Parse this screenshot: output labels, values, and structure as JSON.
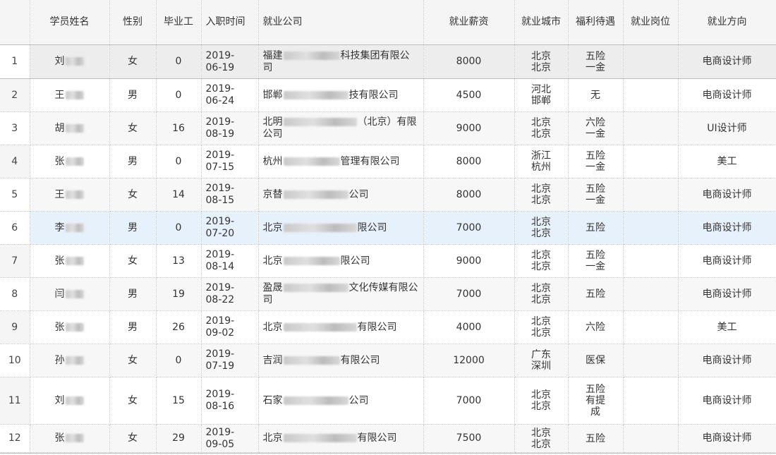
{
  "columns": [
    "",
    "学员姓名",
    "性别",
    "毕业工",
    "入职时间",
    "就业公司",
    "就业薪资",
    "就业城市",
    "福利待遇",
    "就业岗位",
    "就业方向"
  ],
  "rows": [
    {
      "num": "1",
      "name": "刘",
      "gender": "女",
      "years": "0",
      "date": [
        "2019-",
        "06-19"
      ],
      "company_pre": "福建",
      "company_post": "科技集团有限公司",
      "salary": "8000",
      "city": [
        "北京",
        "北京"
      ],
      "welfare": [
        "五险",
        "一金"
      ],
      "position": "",
      "direction": "电商设计师"
    },
    {
      "num": "2",
      "name": "王",
      "gender": "男",
      "years": "0",
      "date": [
        "2019-",
        "06-24"
      ],
      "company_pre": "邯郸",
      "company_post": "技有限公司",
      "salary": "4500",
      "city": [
        "河北",
        "邯郸"
      ],
      "welfare": [
        "无"
      ],
      "position": "",
      "direction": "电商设计师"
    },
    {
      "num": "3",
      "name": "胡",
      "gender": "女",
      "years": "16",
      "date": [
        "2019-",
        "08-19"
      ],
      "company_pre": "北明",
      "company_post": "（北京）有限公司",
      "salary": "9000",
      "city": [
        "北京",
        "北京"
      ],
      "welfare": [
        "六险",
        "一金"
      ],
      "position": "",
      "direction": "UI设计师"
    },
    {
      "num": "4",
      "name": "张",
      "gender": "男",
      "years": "0",
      "date": [
        "2019-",
        "07-15"
      ],
      "company_pre": "杭州",
      "company_post": "管理有限公司",
      "salary": "8000",
      "city": [
        "浙江",
        "杭州"
      ],
      "welfare": [
        "五险",
        "一金"
      ],
      "position": "",
      "direction": "美工"
    },
    {
      "num": "5",
      "name": "王",
      "gender": "女",
      "years": "14",
      "date": [
        "2019-",
        "08-15"
      ],
      "company_pre": "京替",
      "company_post": "公司",
      "salary": "8000",
      "city": [
        "北京",
        "北京"
      ],
      "welfare": [
        "五险",
        "一金"
      ],
      "position": "",
      "direction": "电商设计师"
    },
    {
      "num": "6",
      "name": "李",
      "gender": "男",
      "years": "0",
      "date": [
        "2019-",
        "07-20"
      ],
      "company_pre": "北京",
      "company_post": "限公司",
      "salary": "7000",
      "city": [
        "北京",
        "北京"
      ],
      "welfare": [
        "五险"
      ],
      "position": "",
      "direction": "电商设计师"
    },
    {
      "num": "7",
      "name": "张",
      "gender": "女",
      "years": "13",
      "date": [
        "2019-",
        "08-14"
      ],
      "company_pre": "北京",
      "company_post": "限公司",
      "salary": "9000",
      "city": [
        "北京",
        "北京"
      ],
      "welfare": [
        "五险",
        "一金"
      ],
      "position": "",
      "direction": "电商设计师"
    },
    {
      "num": "8",
      "name": "闫",
      "gender": "男",
      "years": "19",
      "date": [
        "2019-",
        "08-22"
      ],
      "company_pre": "盈晟",
      "company_post": "文化传媒有限公司",
      "salary": "7000",
      "city": [
        "北京",
        "北京"
      ],
      "welfare": [
        "五险"
      ],
      "position": "",
      "direction": "电商设计师"
    },
    {
      "num": "9",
      "name": "张",
      "gender": "男",
      "years": "26",
      "date": [
        "2019-",
        "09-02"
      ],
      "company_pre": "北京",
      "company_post": "有限公司",
      "salary": "4000",
      "city": [
        "北京",
        "北京"
      ],
      "welfare": [
        "六险"
      ],
      "position": "",
      "direction": "美工"
    },
    {
      "num": "10",
      "name": "孙",
      "gender": "女",
      "years": "0",
      "date": [
        "2019-",
        "07-19"
      ],
      "company_pre": "吉润",
      "company_post": "有限公司",
      "salary": "12000",
      "city": [
        "广东",
        "深圳"
      ],
      "welfare": [
        "医保"
      ],
      "position": "",
      "direction": "电商设计师"
    },
    {
      "num": "11",
      "name": "刘",
      "gender": "女",
      "years": "15",
      "date": [
        "2019-",
        "08-16"
      ],
      "company_pre": "石家",
      "company_post": "公司",
      "salary": "7000",
      "city": [
        "北京",
        "北京"
      ],
      "welfare": [
        "五险",
        "有提",
        "成"
      ],
      "position": "",
      "direction": "电商设计师"
    },
    {
      "num": "12",
      "name": "张",
      "gender": "女",
      "years": "29",
      "date": [
        "2019-",
        "09-05"
      ],
      "company_pre": "北京",
      "company_post": "有限公司",
      "salary": "7500",
      "city": [
        "北京",
        "北京"
      ],
      "welfare": [
        "五险"
      ],
      "position": "",
      "direction": "电商设计师"
    }
  ]
}
